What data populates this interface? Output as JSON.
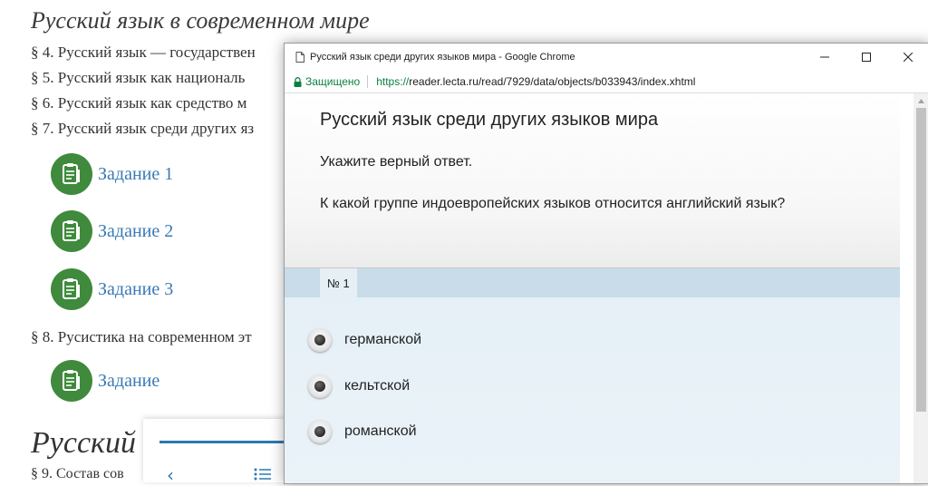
{
  "background_page": {
    "title": "Русский язык в современном мире",
    "sections": [
      "§ 4. Русский язык — государствен",
      "§ 5. Русский язык как националь",
      "§ 6. Русский язык как средство м",
      "§ 7. Русский язык среди других яз"
    ],
    "tasks": [
      "Задание 1",
      "Задание 2",
      "Задание 3"
    ],
    "section8": "§ 8. Русистика на современном эт",
    "task_single": "Задание",
    "title2": "Русский",
    "section9": "§ 9. Состав сов"
  },
  "chrome_window": {
    "title": "Русский язык среди других языков мира - Google Chrome",
    "secure_label": "Защищено",
    "url_scheme": "https://",
    "url_rest": "reader.lecta.ru/read/7929/data/objects/b033943/index.xhtml"
  },
  "task_panel": {
    "title": "Русский язык среди других языков мира",
    "instruction": "Укажите верный ответ.",
    "question": "К какой группе индоевропейских языков относится английский язык?",
    "tab_label": "№ 1",
    "answers": [
      "германской",
      "кельтской",
      "романской"
    ]
  },
  "colors": {
    "task_icon_green": "#3f8a3c",
    "link_blue": "#3a7ab4",
    "secure_green": "#0b8043",
    "accent_blue": "#2a7ab0"
  },
  "icons": {
    "task": "clipboard-icon",
    "back": "chevron-left-icon",
    "list": "list-icon",
    "page": "page-icon",
    "lock": "lock-icon",
    "minimize": "minimize-icon",
    "maximize": "maximize-icon",
    "close": "close-icon"
  }
}
